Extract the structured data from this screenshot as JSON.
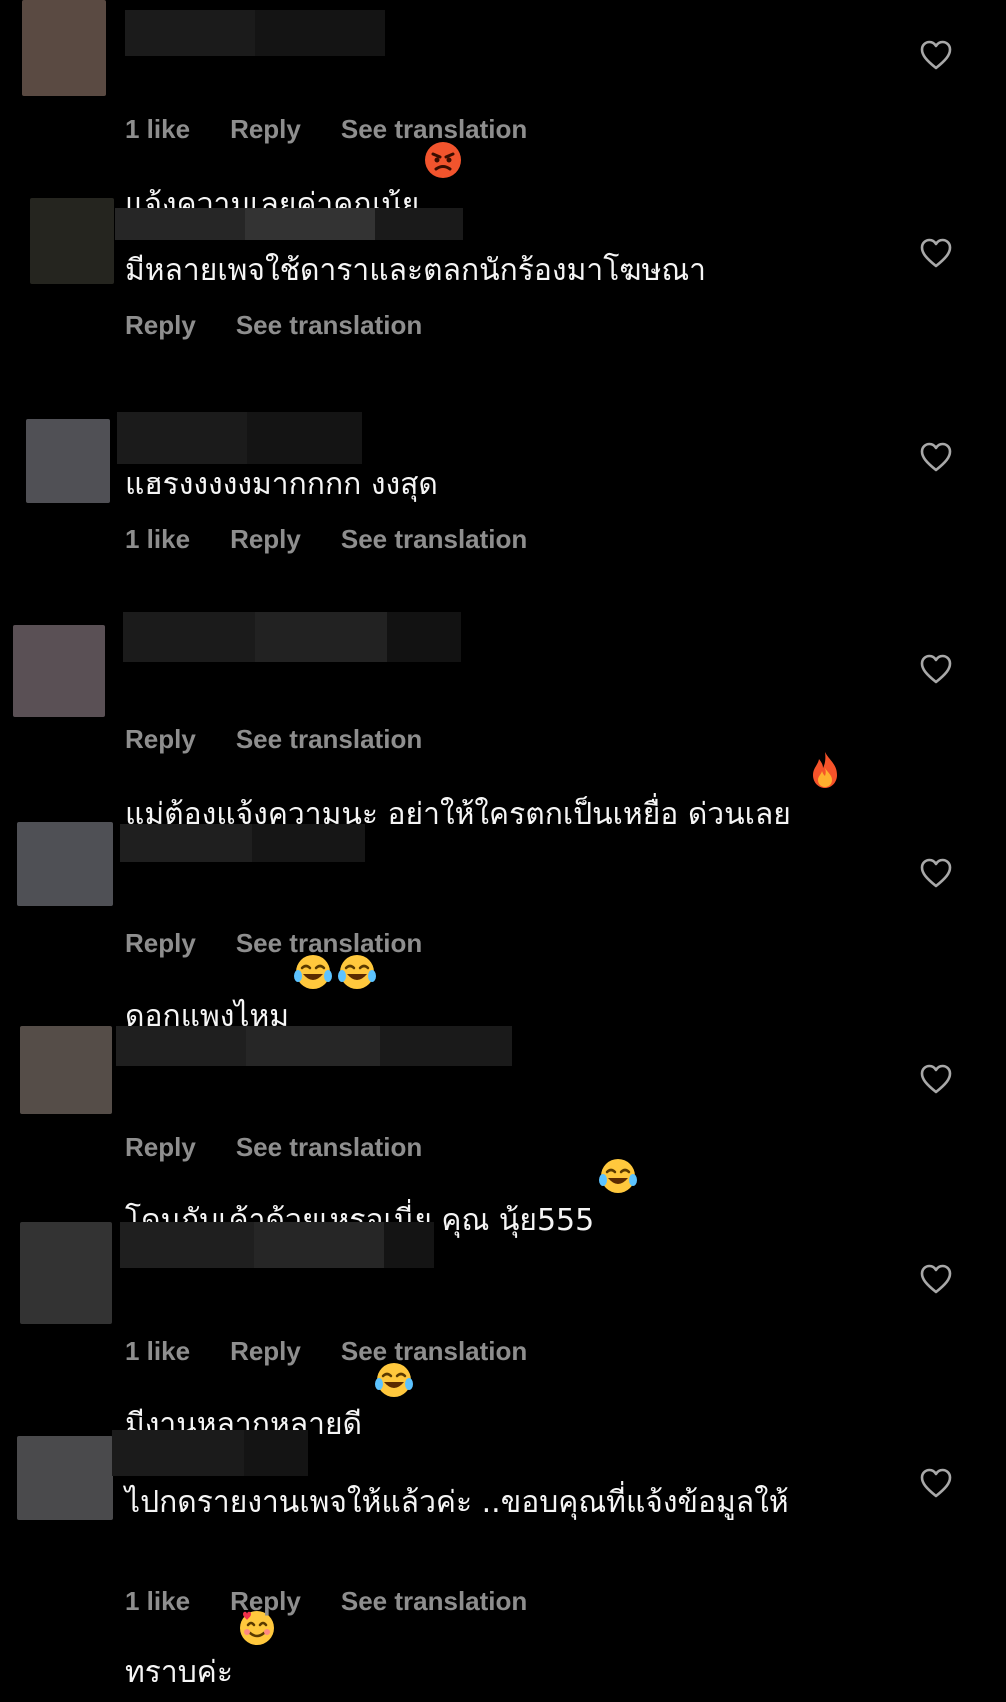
{
  "comments": [
    {
      "text": "แจ้งความเลยค่าคุณนุ้ย",
      "emojis": [
        "angry-face"
      ],
      "likes": "1 like",
      "reply": "Reply",
      "see_translation": "See translation",
      "avatar_color": "#5a4a42"
    },
    {
      "text": "มีหลายเพจใช้ดาราและตลกนักร้องมาโฆษณา",
      "emojis": [],
      "likes": "",
      "reply": "Reply",
      "see_translation": "See translation",
      "avatar_color": "#25251f"
    },
    {
      "text": "แฮรงงงงงมากกกก งงสุด",
      "emojis": [],
      "likes": "1 like",
      "reply": "Reply",
      "see_translation": "See translation",
      "avatar_color": "#505055"
    },
    {
      "text": "แม่ต้องแจ้งความนะ อย่าให้ใครตกเป็นเหยื่อ ด่วนเลย",
      "emojis": [
        "fire"
      ],
      "likes": "",
      "reply": "Reply",
      "see_translation": "See translation",
      "avatar_color": "#5a5055"
    },
    {
      "text": "ดอกแพงไหม",
      "emojis": [
        "face-with-tears-of-joy",
        "face-with-tears-of-joy"
      ],
      "likes": "",
      "reply": "Reply",
      "see_translation": "See translation",
      "avatar_color": "#4f5055"
    },
    {
      "text": "โดนกับเค้าด้วยเหรอเนี่ย คุณ นุ้ย555",
      "emojis": [
        "face-with-tears-of-joy"
      ],
      "likes": "",
      "reply": "Reply",
      "see_translation": "See translation",
      "avatar_color": "#554d48"
    },
    {
      "text": "มีงานหลากหลายดี",
      "emojis": [
        "face-with-tears-of-joy"
      ],
      "likes": "1 like",
      "reply": "Reply",
      "see_translation": "See translation",
      "avatar_color": "#333333"
    },
    {
      "text": "ไปกดรายงานเพจให้แล้วค่ะ ..ขอบคุณที่แจ้งข้อมูลให้ทราบค่ะ",
      "emojis": [
        "smiling-face-with-hearts"
      ],
      "likes": "1 like",
      "reply": "Reply",
      "see_translation": "See translation",
      "avatar_color": "#4a4a4c"
    }
  ],
  "colors": {
    "background": "#000000",
    "text": "#f5f5f5",
    "meta_text": "#8e8e8e",
    "blur_block_dark": "#141414",
    "blur_block_mid": "#1e1e1e",
    "blur_block_light": "#2a2a2a"
  }
}
